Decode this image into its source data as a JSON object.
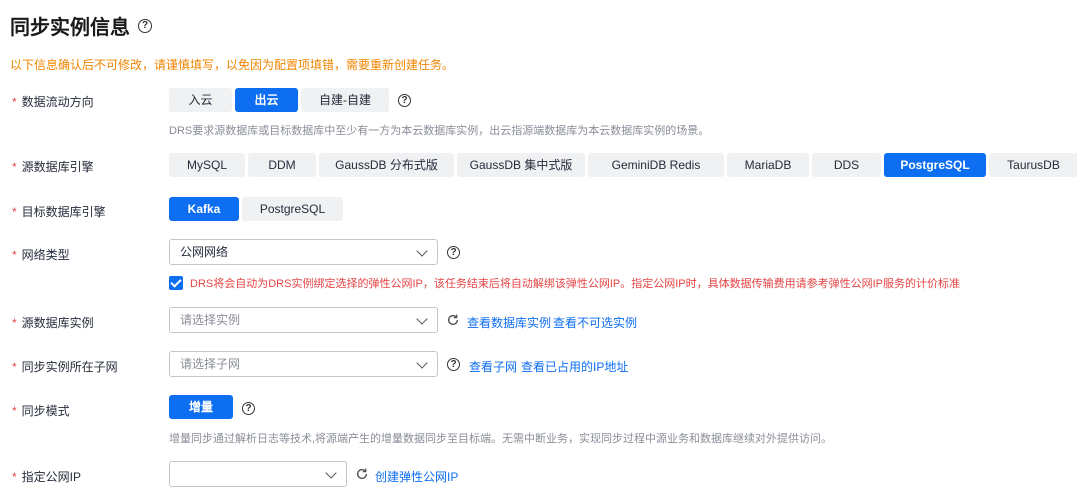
{
  "page": {
    "title": "同步实例信息",
    "notice": "以下信息确认后不可修改，请谨慎填写，以免因为配置项填错，需要重新创建任务。"
  },
  "flow_direction": {
    "label": "数据流动方向",
    "options": [
      "入云",
      "出云",
      "自建-自建"
    ],
    "selected": "出云",
    "hint": "DRS要求源数据库或目标数据库中至少有一方为本云数据库实例，出云指源端数据库为本云数据库实例的场景。"
  },
  "source_engine": {
    "label": "源数据库引擎",
    "options": [
      "MySQL",
      "DDM",
      "GaussDB 分布式版",
      "GaussDB 集中式版",
      "GeminiDB Redis",
      "MariaDB",
      "DDS",
      "PostgreSQL",
      "TaurusDB"
    ],
    "selected": "PostgreSQL"
  },
  "target_engine": {
    "label": "目标数据库引擎",
    "options": [
      "Kafka",
      "PostgreSQL"
    ],
    "selected": "Kafka"
  },
  "network_type": {
    "label": "网络类型",
    "value": "公网网络",
    "checkbox_checked": true,
    "checkbox_text": "DRS将会自动为DRS实例绑定选择的弹性公网IP，该任务结束后将自动解绑该弹性公网IP。指定公网IP时，具体数据传输费用请参考弹性公网IP服务的计价标准"
  },
  "source_instance": {
    "label": "源数据库实例",
    "placeholder": "请选择实例",
    "link_view": "查看数据库实例",
    "link_unselectable": "查看不可选实例"
  },
  "subnet": {
    "label": "同步实例所在子网",
    "placeholder": "请选择子网",
    "link_view": "查看子网",
    "link_used_ip": "查看已占用的IP地址"
  },
  "sync_mode": {
    "label": "同步模式",
    "option": "增量",
    "hint": "增量同步通过解析日志等技术,将源端产生的增量数据同步至目标端。无需中断业务，实现同步过程中源业务和数据库继续对外提供访问。"
  },
  "public_ip": {
    "label": "指定公网IP",
    "value": "",
    "link_create": "创建弹性公网IP"
  },
  "colors": {
    "primary": "#0e6ef2",
    "warning": "#f08400",
    "error": "#e54545"
  },
  "icons": [
    "help-icon",
    "chevron-down-icon",
    "refresh-icon",
    "checkbox-checked-icon"
  ]
}
